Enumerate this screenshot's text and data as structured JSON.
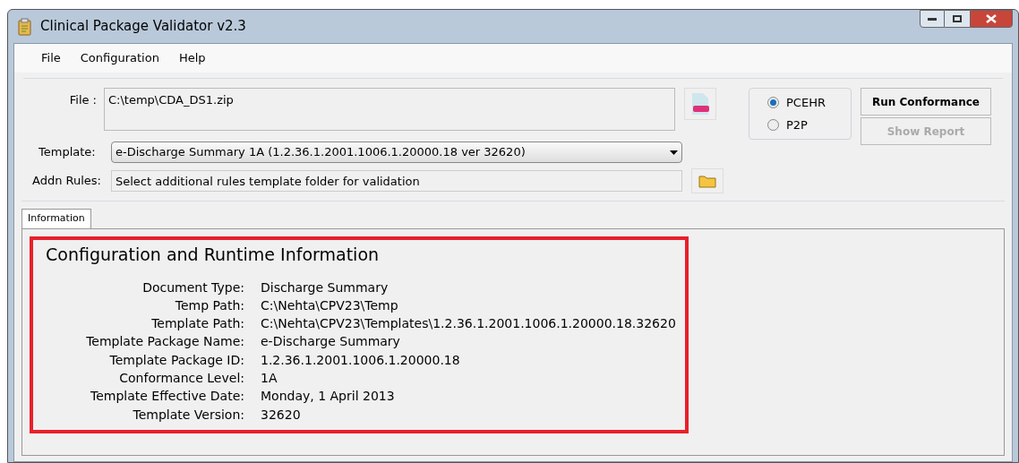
{
  "window": {
    "title": "Clinical Package Validator v2.3"
  },
  "menu": [
    "File",
    "Configuration",
    "Help"
  ],
  "file": {
    "label": "File :",
    "value": "C:\\temp\\CDA_DS1.zip"
  },
  "template": {
    "label": "Template:",
    "value": "e-Discharge Summary 1A  (1.2.36.1.2001.1006.1.20000.18 ver 32620)"
  },
  "addn_rules": {
    "label": "Addn Rules:",
    "placeholder": "Select additional rules template folder for validation"
  },
  "modes": [
    {
      "label": "PCEHR",
      "selected": true
    },
    {
      "label": "P2P",
      "selected": false
    }
  ],
  "buttons": [
    {
      "label": "Run Conformance",
      "disabled": false
    },
    {
      "label": "Show Report",
      "disabled": true
    }
  ],
  "tabs": [
    {
      "label": "Information",
      "selected": true
    }
  ],
  "info": {
    "title": "Configuration and Runtime Information",
    "rows": [
      {
        "label": "Document Type:",
        "value": "Discharge Summary"
      },
      {
        "label": "Temp Path:",
        "value": "C:\\Nehta\\CPV23\\Temp"
      },
      {
        "label": "Template Path:",
        "value": "C:\\Nehta\\CPV23\\Templates\\1.2.36.1.2001.1006.1.20000.18.32620"
      },
      {
        "label": "Template Package Name:",
        "value": "e-Discharge Summary"
      },
      {
        "label": "Template Package ID:",
        "value": "1.2.36.1.2001.1006.1.20000.18"
      },
      {
        "label": "Conformance Level:",
        "value": "1A"
      },
      {
        "label": "Template Effective Date:",
        "value": "Monday, 1 April 2013"
      },
      {
        "label": "Template Version:",
        "value": "32620"
      }
    ]
  }
}
